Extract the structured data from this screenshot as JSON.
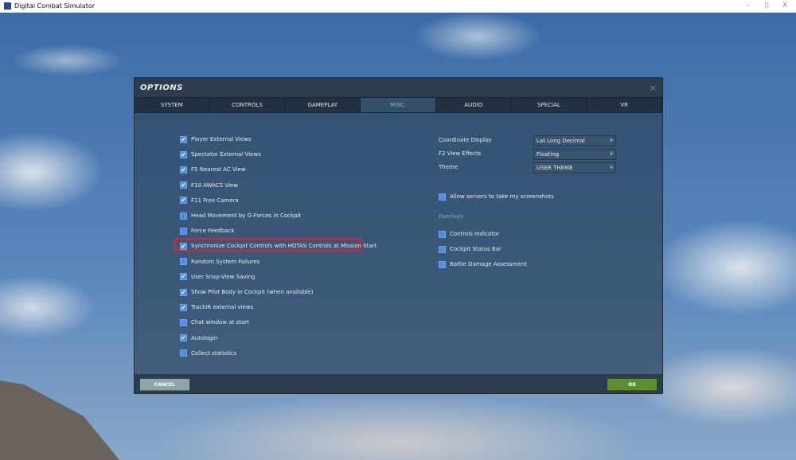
{
  "window": {
    "title": "Digital Combat Simulator",
    "minimize": "–",
    "maximize": "▯",
    "close": "X"
  },
  "dialog": {
    "title": "OPTIONS",
    "close": "×"
  },
  "tabs": [
    {
      "label": "SYSTEM"
    },
    {
      "label": "CONTROLS"
    },
    {
      "label": "GAMEPLAY"
    },
    {
      "label": "MISC.",
      "active": true
    },
    {
      "label": "AUDIO"
    },
    {
      "label": "SPECIAL"
    },
    {
      "label": "VR"
    }
  ],
  "left_options": [
    {
      "label": "Player External Views",
      "checked": true
    },
    {
      "label": "Spectator External Views",
      "checked": true
    },
    {
      "label": "F5 Nearest AC View",
      "checked": true
    },
    {
      "label": "F10 AWACS View",
      "checked": true
    },
    {
      "label": "F11 Free Camera",
      "checked": true
    },
    {
      "label": "Head Movement by G-Forces in Cockpit",
      "checked": false
    },
    {
      "label": "Force Feedback",
      "checked": false
    },
    {
      "label": "Synchronize Cockpit Controls with HOTAS Controls at Mission Start",
      "checked": true
    },
    {
      "label": "Random System Failures",
      "checked": false
    },
    {
      "label": "User Snap-View Saving",
      "checked": true
    },
    {
      "label": "Show Pilot Body in Cockpit (when available)",
      "checked": true
    },
    {
      "label": "TrackIR external views",
      "checked": true
    },
    {
      "label": "Chat window at start",
      "checked": false
    },
    {
      "label": "Autologin",
      "checked": true
    },
    {
      "label": "Collect statistics",
      "checked": false
    }
  ],
  "selects": [
    {
      "label": "Coordinate Display",
      "value": "Lat Long Decimal"
    },
    {
      "label": "F2 View Effects",
      "value": "Floating"
    },
    {
      "label": "Theme",
      "value": "USER THEME"
    }
  ],
  "allow_screenshots": {
    "label": "Allow servers to take my screenshots",
    "checked": false
  },
  "overlays": {
    "heading": "Overlays",
    "items": [
      {
        "label": "Controls Indicator",
        "checked": false
      },
      {
        "label": "Cockpit Status Bar",
        "checked": false
      },
      {
        "label": "Battle Damage Assessment",
        "checked": false
      }
    ]
  },
  "footer": {
    "cancel": "CANCEL",
    "ok": "OK"
  },
  "check_glyph": "✔"
}
